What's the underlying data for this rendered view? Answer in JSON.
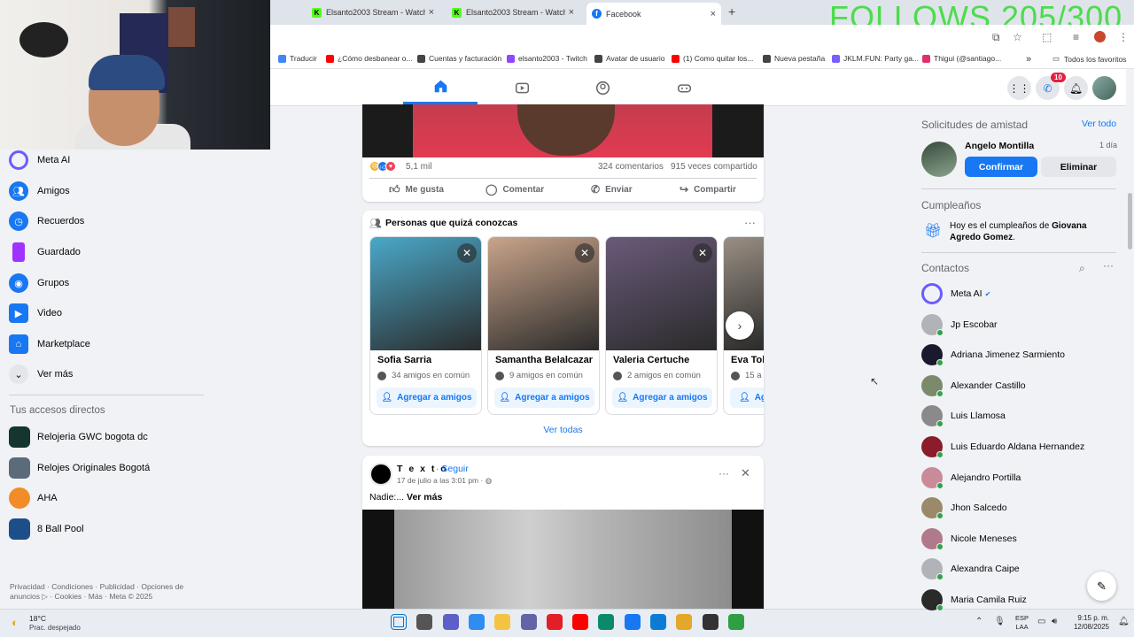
{
  "browser": {
    "tabs": [
      {
        "label": "Elsanto2003 Stream - Watch Li...",
        "icon": "kick-icon"
      },
      {
        "label": "Elsanto2003 Stream - Watch Li...",
        "icon": "kick-icon"
      },
      {
        "label": "Facebook",
        "icon": "facebook-icon",
        "active": true
      }
    ],
    "overlay_text": "FOLLOWS 205/300",
    "bookmarks": [
      {
        "label": "Traducir",
        "color": "#4285f4"
      },
      {
        "label": "¿Cómo desbanear o...",
        "color": "#ff0000"
      },
      {
        "label": "Cuentas y facturación",
        "color": "#444444"
      },
      {
        "label": "elsanto2003 - Twitch",
        "color": "#9146ff"
      },
      {
        "label": "Avatar de usuario",
        "color": "#444444"
      },
      {
        "label": "(1) Como quitar los...",
        "color": "#ff0000"
      },
      {
        "label": "Nueva pestaña",
        "color": "#444444"
      },
      {
        "label": "JKLM.FUN: Party ga...",
        "color": "#7b5cff"
      },
      {
        "label": "Thigui (@santiago...",
        "color": "#e1306c"
      }
    ],
    "all_bookmarks": "Todos los favoritos"
  },
  "fb_nav": {
    "tabs": [
      "home-icon",
      "video-icon",
      "groups-icon",
      "gaming-icon"
    ],
    "messenger_badge": "10"
  },
  "sidebar": {
    "items": [
      {
        "label": "Meta AI",
        "color": "#6a5cff"
      },
      {
        "label": "Amigos",
        "color": "#1877f2"
      },
      {
        "label": "Recuerdos",
        "color": "#1877f2"
      },
      {
        "label": "Guardado",
        "color": "#a033ff"
      },
      {
        "label": "Grupos",
        "color": "#1877f2"
      },
      {
        "label": "Video",
        "color": "#1877f2"
      },
      {
        "label": "Marketplace",
        "color": "#1877f2"
      },
      {
        "label": "Ver más",
        "color": "#e4e6eb"
      }
    ],
    "shortcuts_title": "Tus accesos directos",
    "shortcuts": [
      {
        "label": "Relojeria GWC bogota dc",
        "color": "#16352e"
      },
      {
        "label": "Relojes Originales Bogotá",
        "color": "#5b6b7a"
      },
      {
        "label": "AHA",
        "color": "#f28c28"
      },
      {
        "label": "8 Ball Pool",
        "color": "#1c4f8a"
      }
    ],
    "footer": "Privacidad · Condiciones · Publicidad · Opciones de anuncios ▷ · Cookies · Más · Meta © 2025"
  },
  "post1": {
    "reactions_count": "5,1 mil",
    "comments": "324 comentarios",
    "shares": "915 veces compartido",
    "actions": [
      "Me gusta",
      "Comentar",
      "Enviar",
      "Compartir"
    ]
  },
  "pymk": {
    "title": "Personas que quizá conozcas",
    "people": [
      {
        "name": "Sofia Sarria",
        "mutual": "34 amigos en común",
        "photo": "#4aa8c9"
      },
      {
        "name": "Samantha Belalcazar",
        "mutual": "9 amigos en común",
        "photo": "#c9a48a"
      },
      {
        "name": "Valeria Certuche",
        "mutual": "2 amigos en común",
        "photo": "#6a5a7a"
      },
      {
        "name": "Eva Tob",
        "mutual": "15 a",
        "photo": "#9a8f84"
      }
    ],
    "add_label": "Agregar a amigos",
    "see_all": "Ver todas"
  },
  "post2": {
    "author": "T e x t o",
    "follow": "· Seguir",
    "date": "17 de julio a las 3:01 pm ·",
    "text": "Nadie:...",
    "more": "Ver más"
  },
  "right": {
    "requests_title": "Solicitudes de amistad",
    "see_all": "Ver todo",
    "request": {
      "name": "Angelo Montilla",
      "time": "1 día",
      "confirm": "Confirmar",
      "delete": "Eliminar"
    },
    "birthday_title": "Cumpleaños",
    "birthday_prefix": "Hoy es el cumpleaños de ",
    "birthday_name": "Giovana Agredo Gomez",
    "birthday_suffix": ".",
    "contacts_title": "Contactos",
    "contacts": [
      {
        "name": "Meta AI",
        "color": "#6a5cff",
        "online": false,
        "verified": true
      },
      {
        "name": "Jp Escobar",
        "color": "#b0b3b8",
        "online": true
      },
      {
        "name": "Adriana Jimenez Sarmiento",
        "color": "#1a1a2e",
        "online": true
      },
      {
        "name": "Alexander Castillo",
        "color": "#7a8a6a",
        "online": true
      },
      {
        "name": "Luis Llamosa",
        "color": "#8a8a8a",
        "online": true
      },
      {
        "name": "Luis Eduardo Aldana Hernandez",
        "color": "#8a1c2b",
        "online": true
      },
      {
        "name": "Alejandro Portilla",
        "color": "#c98a9a",
        "online": true
      },
      {
        "name": "Jhon Salcedo",
        "color": "#9a8a6a",
        "online": true
      },
      {
        "name": "Nicole Meneses",
        "color": "#b07a8a",
        "online": true
      },
      {
        "name": "Alexandra Caipe",
        "color": "#b0b3b8",
        "online": true
      },
      {
        "name": "Maria Camila Ruiz",
        "color": "#2a2a2a",
        "online": true
      }
    ]
  },
  "taskbar": {
    "temp": "18°C",
    "weather": "Prac. despejado",
    "lang_line1": "ESP",
    "lang_line2": "LAA",
    "time": "9:15 p. m.",
    "date": "12/08/2025",
    "apps": [
      "#0078d4",
      "#555555",
      "#5b5fc7",
      "#2f8cf0",
      "#f5c342",
      "#6264a7",
      "#e21f26",
      "#ff0000",
      "#0b8a6b",
      "#1877f2",
      "#0c7bd4",
      "#e4a72a",
      "#333333",
      "#2ea043"
    ]
  }
}
